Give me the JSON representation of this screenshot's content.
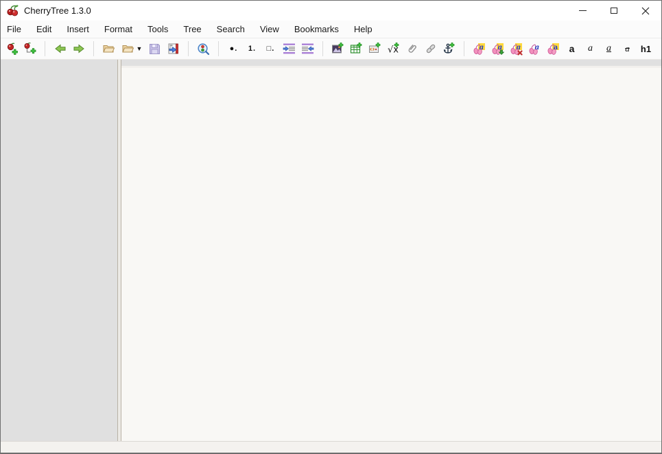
{
  "titlebar": {
    "title": "CherryTree 1.3.0"
  },
  "menubar": {
    "items": [
      "File",
      "Edit",
      "Insert",
      "Format",
      "Tools",
      "Tree",
      "Search",
      "View",
      "Bookmarks",
      "Help"
    ]
  },
  "toolbar": {
    "buttons": [
      "new-node",
      "new-subnode",
      "go-back",
      "go-forward",
      "open-file",
      "recent-docs",
      "save",
      "quit-app",
      "find",
      "bullet-list",
      "numbered-list",
      "todo-list",
      "indent",
      "unindent",
      "insert-image",
      "insert-table",
      "insert-codebox",
      "insert-latex",
      "insert-attached-file",
      "insert-link",
      "insert-anchor",
      "format-latest",
      "format-apply",
      "format-clear",
      "text-color-foreground",
      "text-color-background",
      "bold",
      "italic",
      "underline",
      "strikethrough",
      "heading-h1",
      "heading-dropdown"
    ],
    "glyphs": {
      "dropdown": "▼",
      "bullet_list": "●.",
      "numbered_list": "1.",
      "todo_list": "□.",
      "latex": "√x",
      "bold": "a",
      "italic": "a",
      "underline": "a",
      "strikethrough": "a",
      "heading": "h1"
    },
    "save_disabled": true
  },
  "icons": {
    "cherrytree-logo-icon": "two red cherries with green stems",
    "minimize-icon": "horizontal line",
    "maximize-icon": "hollow square",
    "close-icon": "diagonal cross",
    "new-node-icon": "cherry with green plus",
    "new-subnode-icon": "cherry, elbow connector and green plus",
    "go-back-icon": "green left arrow",
    "go-forward-icon": "green right arrow",
    "open-file-icon": "manila open folder",
    "recent-docs-icon": "manila folder with dropdown triangle",
    "save-icon": "lavender floppy disk (disabled)",
    "quit-app-icon": "panel with red edge and blue exit arrow",
    "find-icon": "blue magnifier with red and green dots",
    "indent-icon": "purple bars with right blue arrow",
    "unindent-icon": "purple bars with left blue arrow",
    "insert-image-icon": "picture with green plus",
    "insert-table-icon": "green grid with green plus",
    "insert-codebox-icon": "gray box with code marks and green plus",
    "insert-latex-icon": "square root x with green plus",
    "paperclip-icon": "gray paperclip",
    "link-icon": "gray chain links",
    "anchor-icon": "dark anchor with green plus",
    "format-latest-icon": "pink cherries, italic a on yellow",
    "format-apply-icon": "pink cherries, a on yellow, green down arrow",
    "format-clear-icon": "pink cherries, a on yellow, red x",
    "text-color-fg-icon": "pink cherries with blue a",
    "text-color-bg-icon": "pink cherries with blue a on yellow"
  },
  "sidebar": {
    "content": ""
  },
  "editor": {
    "content": ""
  },
  "statusbar": {
    "text": ""
  },
  "colors": {
    "window_border": "#6e6e6e",
    "titlebar_bg": "#ffffff",
    "menubar_bg": "#fbfbfb",
    "toolbar_bg": "#fbfbfb",
    "tree_panel_bg": "#e0e0e0",
    "editor_bg": "#f9f8f5",
    "statusbar_bg": "#f4f2ef",
    "accent_green": "#44c544",
    "accent_red": "#c22a2a",
    "accent_blue": "#4f7fd9",
    "accent_purple": "#aa7fd6",
    "accent_pink": "#f291bd",
    "accent_yellow": "#ffd93e"
  }
}
